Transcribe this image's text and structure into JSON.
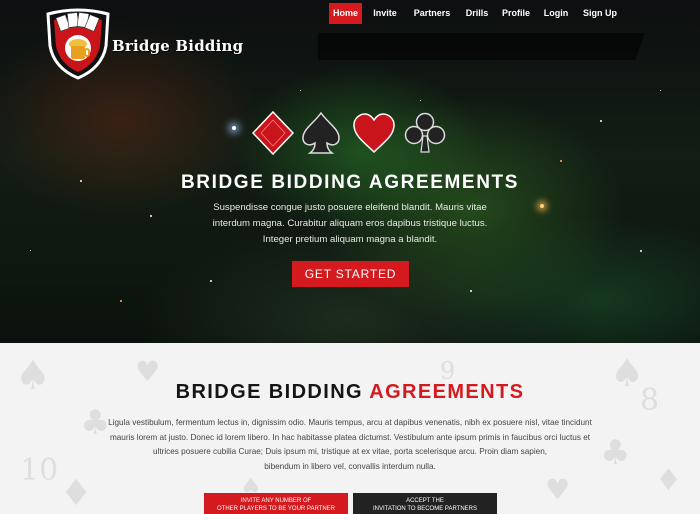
{
  "brand": {
    "name": "Bridge Bidding"
  },
  "nav": {
    "items": [
      "Home",
      "Invite",
      "Partners",
      "Drills",
      "Profile",
      "Login",
      "Sign Up"
    ],
    "active": "Home"
  },
  "hero": {
    "suits": [
      "diamond-icon",
      "spade-icon",
      "heart-icon",
      "club-icon"
    ],
    "title": "BRIDGE BIDDING AGREEMENTS",
    "lines": [
      "Suspendisse congue justo posuere eleifend blandit. Mauris vitae",
      "interdum magna. Curabitur aliquam eros dapibus tristique luctus.",
      "Integer pretium aliquam magna a blandit."
    ],
    "cta": "GET STARTED"
  },
  "section": {
    "title_part1": "BRIDGE BIDDING ",
    "title_part2": "AGREEMENTS",
    "lines": [
      "Ligula vestibulum, fermentum lectus in, dignissim odio. Mauris tempus, arcu at dapibus venenatis, nibh ex posuere nisl, vitae tincidunt",
      "mauris lorem at justo. Donec id lorem libero. In hac habitasse platea dictumst. Vestibulum ante ipsum primis in faucibus orci luctus et",
      "ultrices posuere cubilia Curae; Duis ipsum mi, tristique at ex vitae, porta scelerisque arcu. Proin diam sapien,",
      "bibendum in libero vel, convallis interdum nulla."
    ],
    "btn_invite_line1": "INVITE ANY NUMBER OF",
    "btn_invite_line2": "OTHER PLAYERS TO BE YOUR PARTNER",
    "btn_accept_line1": "ACCEPT THE",
    "btn_accept_line2": "INVITATION TO BECOME PARTNERS"
  },
  "colors": {
    "accent": "#d41a1f",
    "dark": "#222222"
  }
}
